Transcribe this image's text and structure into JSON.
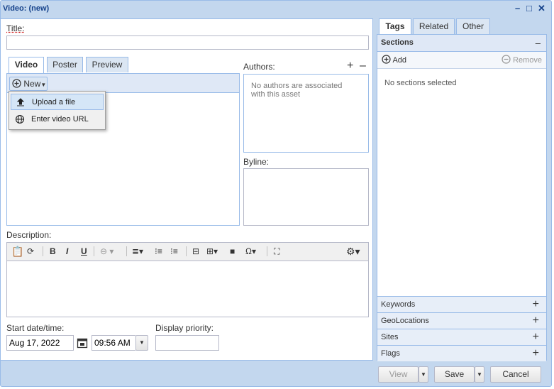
{
  "window": {
    "title": "Video: (new)",
    "controls": [
      "–",
      "□",
      "✕"
    ]
  },
  "form": {
    "title_label": "Title:",
    "title_value": "",
    "media_tabs": [
      "Video",
      "Poster",
      "Preview"
    ],
    "new_button": "New",
    "new_menu": [
      {
        "label": "Upload a file",
        "icon": "upload-icon"
      },
      {
        "label": "Enter video URL",
        "icon": "globe-icon"
      }
    ],
    "authors_label": "Authors:",
    "authors_add": "+",
    "authors_remove": "–",
    "authors_empty": "No authors are associated with this asset",
    "byline_label": "Byline:",
    "description_label": "Description:",
    "start_label": "Start date/time:",
    "start_date": "Aug 17, 2022",
    "start_time": "09:56 AM",
    "priority_label": "Display priority:",
    "priority_value": ""
  },
  "editor_toolbar": {
    "icons": [
      "paste-icon",
      "find-replace-icon",
      "bold-icon",
      "italic-icon",
      "underline-icon",
      "link-icon",
      "align-icon",
      "numbered-list-icon",
      "bullet-list-icon",
      "horizontal-rule-icon",
      "table-icon",
      "video-icon",
      "special-char-icon",
      "fullscreen-icon",
      "settings-icon"
    ],
    "glyphs": {
      "bold": "B",
      "italic": "I",
      "underline": "U",
      "omega": "Ω"
    }
  },
  "sidebar": {
    "tabs": [
      "Tags",
      "Related",
      "Other"
    ],
    "sections_header": "Sections",
    "sections_collapse": "–",
    "add_label": "Add",
    "remove_label": "Remove",
    "empty_text": "No sections selected",
    "accordions": [
      "Keywords",
      "GeoLocations",
      "Sites",
      "Flags"
    ],
    "accordion_glyph": "+"
  },
  "footer": {
    "view": "View",
    "save": "Save",
    "cancel": "Cancel"
  },
  "colors": {
    "frame": "#c3d7ee",
    "border": "#99bbe8",
    "title_text": "#15428b",
    "menu_highlight": "#d5e6f7"
  }
}
